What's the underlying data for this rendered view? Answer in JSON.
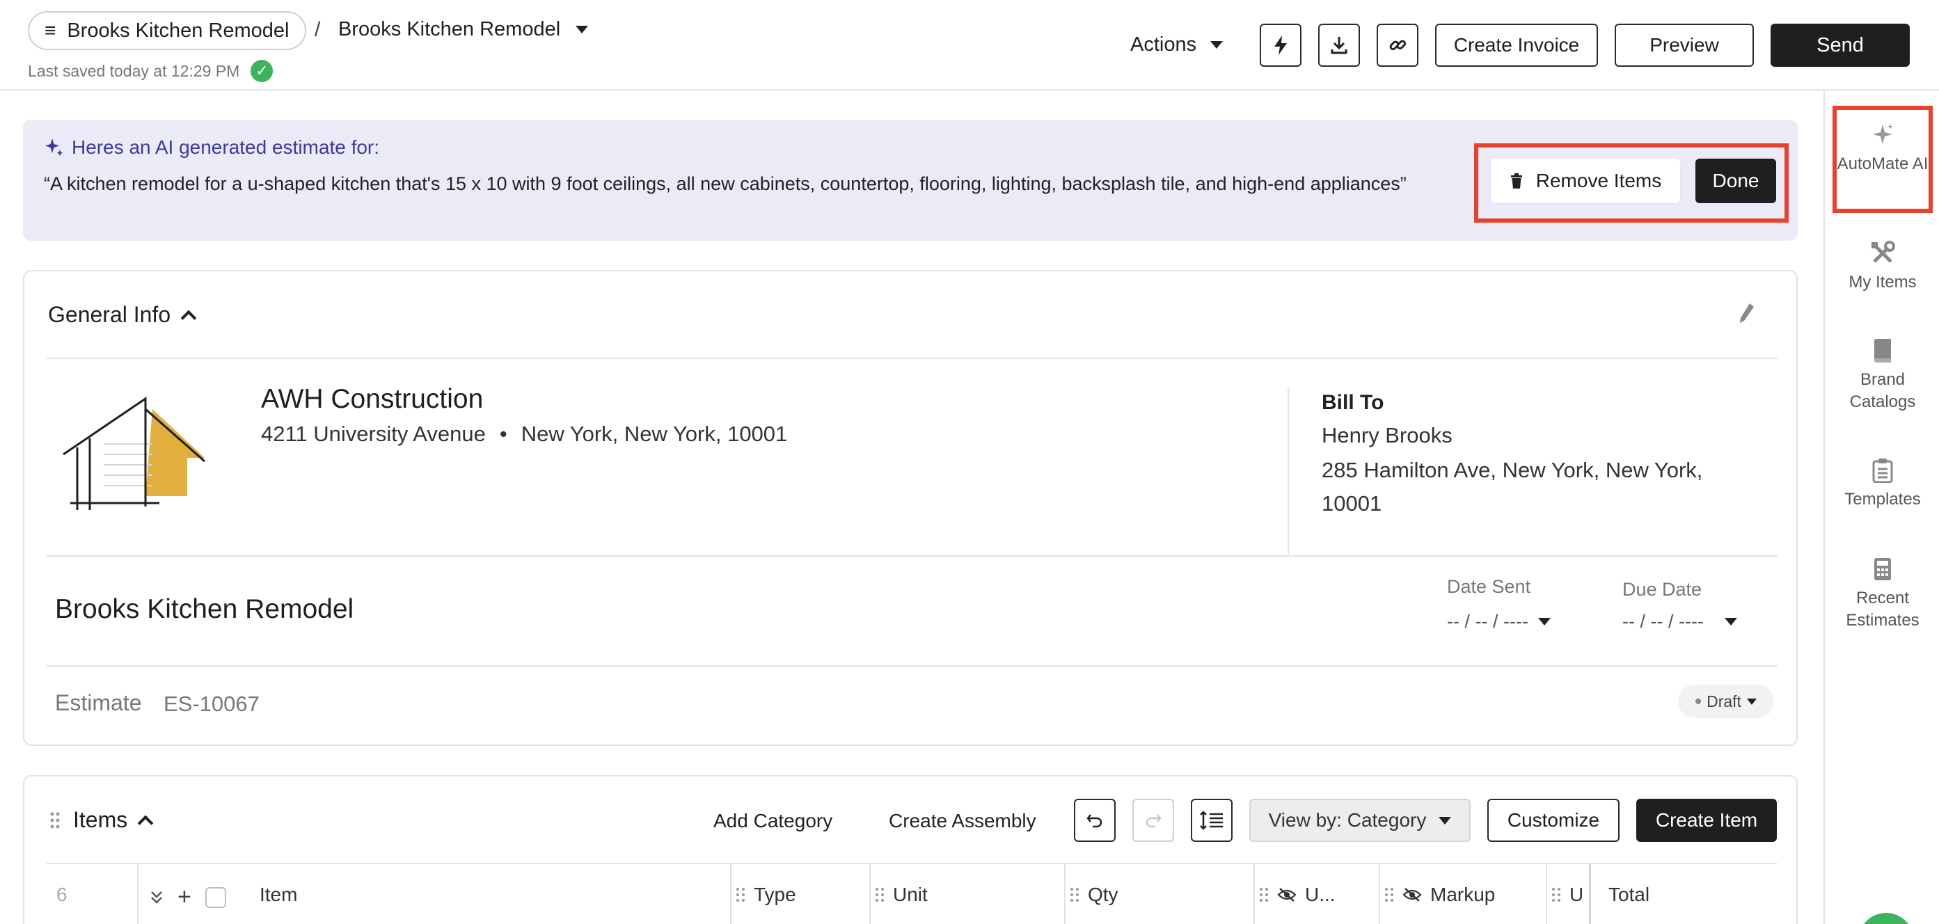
{
  "header": {
    "breadcrumb_root": "Brooks Kitchen Remodel",
    "breadcrumb_current": "Brooks Kitchen Remodel",
    "last_saved": "Last saved today at 12:29 PM",
    "actions_label": "Actions",
    "create_invoice_label": "Create Invoice",
    "preview_label": "Preview",
    "send_label": "Send"
  },
  "banner": {
    "heading": "Heres an AI generated estimate for:",
    "prompt": "“A kitchen remodel for a u-shaped kitchen that's 15 x 10 with 9 foot ceilings, all new cabinets, countertop, flooring, lighting, backsplash tile, and high-end appliances”",
    "remove_items_label": "Remove Items",
    "done_label": "Done"
  },
  "general_info": {
    "title": "General Info",
    "company_name": "AWH Construction",
    "company_street": "4211 University Avenue",
    "company_separator": "•",
    "company_city": "New York, New York, 10001",
    "bill_to_label": "Bill To",
    "bill_to_name": "Henry Brooks",
    "bill_to_address": "285 Hamilton Ave, New York, New York, 10001",
    "project_title": "Brooks Kitchen Remodel",
    "date_sent_label": "Date Sent",
    "date_sent_value": "-- / -- / ----",
    "due_date_label": "Due Date",
    "due_date_value": "-- / -- / ----",
    "estimate_label": "Estimate",
    "estimate_number": "ES-10067",
    "status": "Draft"
  },
  "items": {
    "title": "Items",
    "add_category_label": "Add Category",
    "create_assembly_label": "Create Assembly",
    "view_by_label": "View by: Category",
    "customize_label": "Customize",
    "create_item_label": "Create Item",
    "row_count": "6",
    "columns": {
      "item": "Item",
      "type": "Type",
      "unit": "Unit",
      "qty": "Qty",
      "unit_cost": "U...",
      "markup": "Markup",
      "u": "U",
      "total": "Total"
    }
  },
  "rail": {
    "automate": "AutoMate AI",
    "my_items": "My Items",
    "brand_catalogs": "Brand Catalogs",
    "templates": "Templates",
    "recent_estimates": "Recent Estimates"
  },
  "colors": {
    "accent_highlight": "#e8412c",
    "banner_bg": "#ebeaf7",
    "banner_heading": "#3b3a9e",
    "success": "#3cb45c",
    "dark_button": "#1f1f1f",
    "logo_yellow": "#e2ae3e"
  }
}
